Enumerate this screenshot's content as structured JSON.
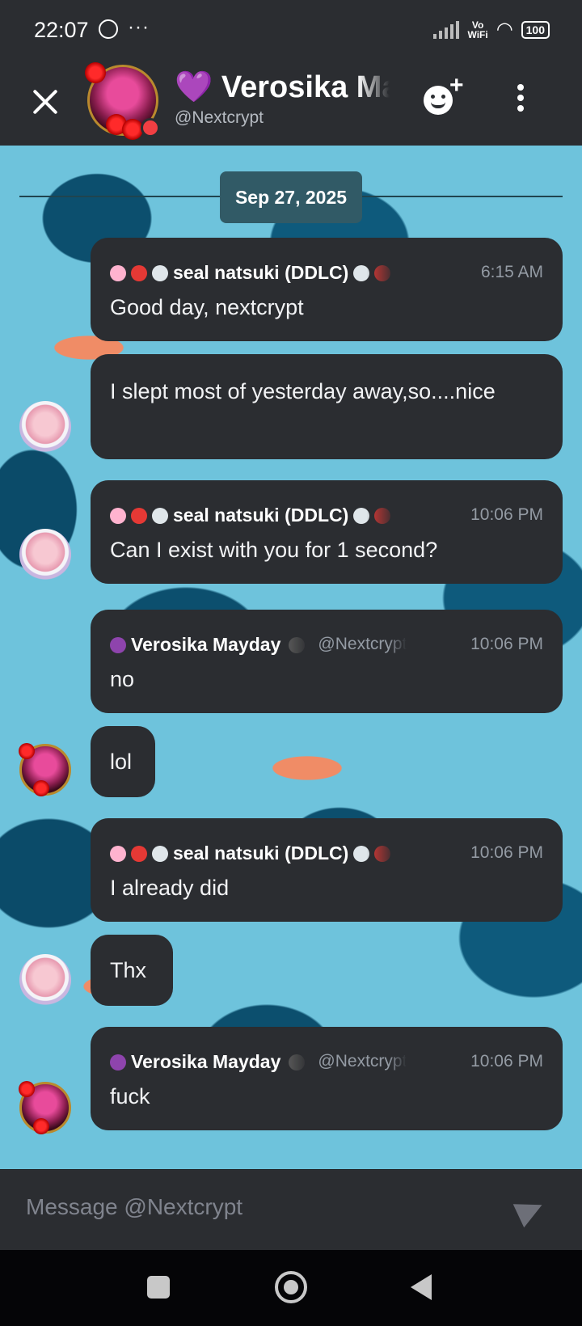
{
  "status_bar": {
    "time": "22:07",
    "dots": "···",
    "vowifi": "Vo\nWiFi",
    "battery": "100"
  },
  "header": {
    "title": "💜 Verosika Mayday 🖤",
    "subtitle": "@Nextcrypt"
  },
  "date_divider": "Sep 27, 2025",
  "messages": [
    {
      "author": "seal natsuki (DDLC)",
      "time": "6:15 AM",
      "text": "Good day, nextcrypt"
    },
    {
      "text": "I slept most of yesterday away,so....nice"
    },
    {
      "author": "seal natsuki (DDLC)",
      "time": "10:06 PM",
      "text": "Can I exist with you for 1 second?"
    },
    {
      "author": "Verosika Mayday",
      "handle": "@Nextcrypt",
      "time": "10:06 PM",
      "text": "no"
    },
    {
      "text": "lol"
    },
    {
      "author": "seal natsuki (DDLC)",
      "time": "10:06 PM",
      "text": "I already did"
    },
    {
      "text": "Thx"
    },
    {
      "author": "Verosika Mayday",
      "handle": "@Nextcrypt",
      "time": "10:06 PM",
      "text": "fuck"
    }
  ],
  "composer": {
    "placeholder": "Message @Nextcrypt"
  },
  "colors": {
    "background": "#2b2d31",
    "wallpaper": "#6ec3dc",
    "muted": "#949ba4"
  },
  "icons": [
    "close-icon",
    "add-friend-icon",
    "more-icon",
    "send-icon",
    "recents-icon",
    "home-icon",
    "back-icon"
  ]
}
